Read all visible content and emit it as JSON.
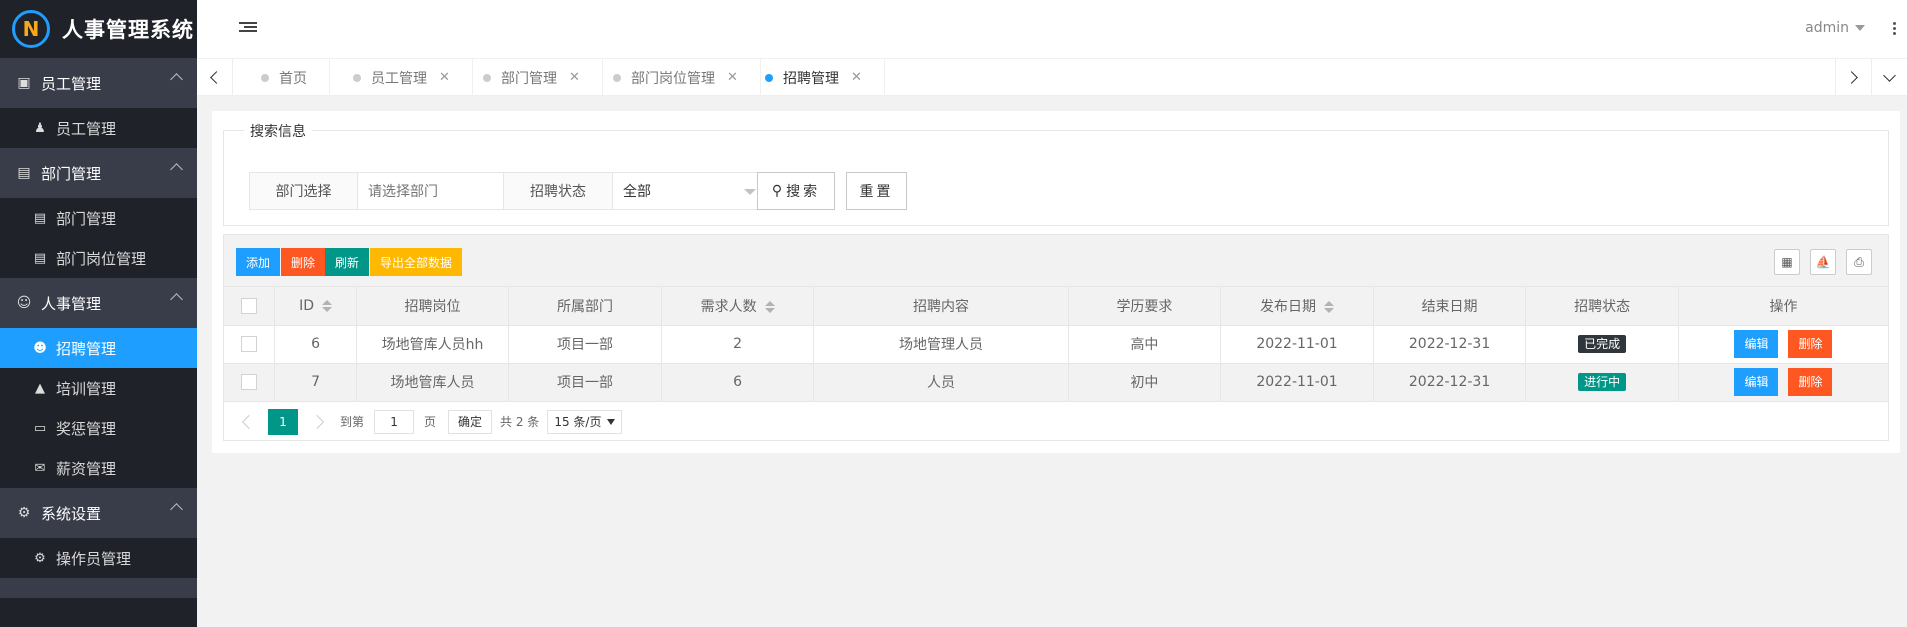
{
  "app": {
    "title": "人事管理系统",
    "logo_letter": "N"
  },
  "sidebar": {
    "groups": [
      {
        "label": "员工管理",
        "icon": "address-card-icon",
        "items": [
          {
            "label": "员工管理",
            "icon": "male-icon"
          }
        ]
      },
      {
        "label": "部门管理",
        "icon": "id-card-icon",
        "items": [
          {
            "label": "部门管理",
            "icon": "id-card-icon"
          },
          {
            "label": "部门岗位管理",
            "icon": "id-card-icon"
          }
        ]
      },
      {
        "label": "人事管理",
        "icon": "users-icon",
        "items": [
          {
            "label": "招聘管理",
            "icon": "user-plus-icon",
            "active": true
          },
          {
            "label": "培训管理",
            "icon": "graduation-cap-icon"
          },
          {
            "label": "奖惩管理",
            "icon": "monitor-icon"
          },
          {
            "label": "薪资管理",
            "icon": "envelope-icon"
          }
        ]
      },
      {
        "label": "系统设置",
        "icon": "gears-icon",
        "items": [
          {
            "label": "操作员管理",
            "icon": "gears-icon"
          }
        ]
      }
    ]
  },
  "header": {
    "user": "admin"
  },
  "tabs": [
    {
      "label": "首页",
      "closable": false
    },
    {
      "label": "员工管理",
      "closable": true
    },
    {
      "label": "部门管理",
      "closable": true
    },
    {
      "label": "部门岗位管理",
      "closable": true
    },
    {
      "label": "招聘管理",
      "closable": true,
      "active": true
    }
  ],
  "search": {
    "legend": "搜索信息",
    "dept_label": "部门选择",
    "dept_placeholder": "请选择部门",
    "status_label": "招聘状态",
    "status_value": "全部",
    "search_button": "搜索",
    "reset_button": "重置"
  },
  "toolbar": {
    "add": "添加",
    "delete": "删除",
    "refresh": "刷新",
    "export": "导出全部数据",
    "colors": {
      "add": "#1e9fff",
      "delete": "#ff5722",
      "refresh": "#009688",
      "export": "#ffb800"
    }
  },
  "table": {
    "columns": [
      "ID",
      "招聘岗位",
      "所属部门",
      "需求人数",
      "招聘内容",
      "学历要求",
      "发布日期",
      "结束日期",
      "招聘状态",
      "操作"
    ],
    "rows": [
      {
        "id": "6",
        "position": "场地管库人员hh",
        "dept": "项目一部",
        "count": "2",
        "content": "场地管理人员",
        "education": "高中",
        "publish": "2022-11-01",
        "end": "2022-12-31",
        "status": "已完成",
        "status_color": "#2f363c"
      },
      {
        "id": "7",
        "position": "场地管库人员",
        "dept": "项目一部",
        "count": "6",
        "content": "人员",
        "education": "初中",
        "publish": "2022-11-01",
        "end": "2022-12-31",
        "status": "进行中",
        "status_color": "#009688"
      }
    ],
    "edit_label": "编辑",
    "delete_label": "删除"
  },
  "pager": {
    "current": "1",
    "goto_label": "到第",
    "goto_value": "1",
    "page_unit": "页",
    "confirm": "确定",
    "total": "共 2 条",
    "page_size": "15 条/页"
  }
}
